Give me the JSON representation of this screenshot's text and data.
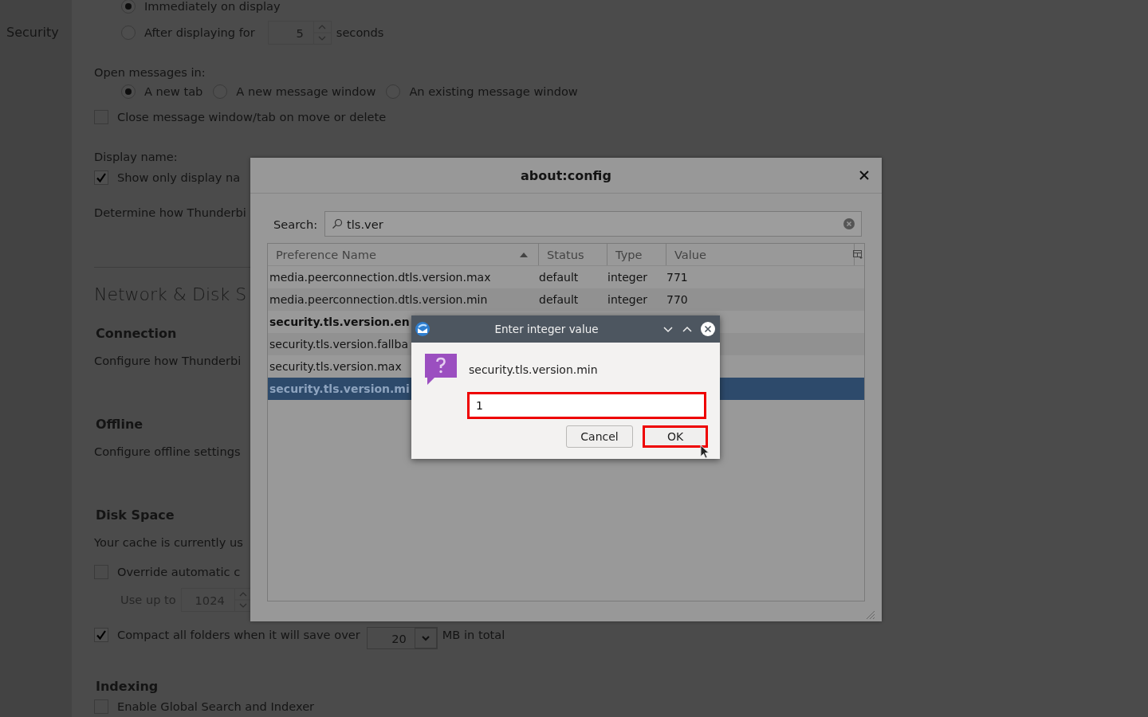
{
  "sidebar": {
    "items": [
      {
        "label": "Security"
      }
    ]
  },
  "settings": [
    {
      "kind": "radio",
      "label": "Immediately on display",
      "selected": true
    },
    {
      "kind": "radio-spin",
      "label": "After displaying for",
      "selected": false,
      "value": "5",
      "unit": "seconds"
    },
    {
      "kind": "label",
      "text": "Open messages in:"
    },
    {
      "kind": "radio-row",
      "options": [
        {
          "label": "A new tab",
          "selected": true
        },
        {
          "label": "A new message window",
          "selected": false
        },
        {
          "label": "An existing message window",
          "selected": false
        }
      ]
    },
    {
      "kind": "checkbox",
      "label": "Close message window/tab on move or delete",
      "checked": false
    },
    {
      "kind": "label",
      "text": "Display name:"
    },
    {
      "kind": "checkbox",
      "label": "Show only display na",
      "checked": true
    },
    {
      "kind": "text",
      "text": "Determine how Thunderbi"
    },
    {
      "kind": "section-title",
      "text": "Network & Disk S"
    },
    {
      "kind": "heading",
      "text": "Connection"
    },
    {
      "kind": "text",
      "text": "Configure how Thunderbi"
    },
    {
      "kind": "heading",
      "text": "Offline"
    },
    {
      "kind": "text",
      "text": "Configure offline settings"
    },
    {
      "kind": "heading",
      "text": "Disk Space"
    },
    {
      "kind": "text",
      "text": "Your cache is currently us"
    },
    {
      "kind": "checkbox",
      "label": "Override automatic c",
      "checked": false
    },
    {
      "kind": "spin",
      "label": "Use up to",
      "value": "1024",
      "disabled": true
    },
    {
      "kind": "checkbox-menu",
      "label": "Compact all folders when it will save over",
      "checked": true,
      "value": "20",
      "unit": "MB in total"
    },
    {
      "kind": "heading",
      "text": "Indexing"
    },
    {
      "kind": "checkbox",
      "label": "Enable Global Search and Indexer",
      "checked": false
    }
  ],
  "config_dialog": {
    "title": "about:config",
    "search": {
      "label": "Search:",
      "value": "tls.ver"
    },
    "table": {
      "columns": [
        "Preference Name",
        "Status",
        "Type",
        "Value"
      ],
      "rows": [
        {
          "name": "media.peerconnection.dtls.version.max",
          "status": "default",
          "type": "integer",
          "value": "771",
          "user_set": false,
          "selected": false
        },
        {
          "name": "media.peerconnection.dtls.version.min",
          "status": "default",
          "type": "integer",
          "value": "770",
          "user_set": false,
          "selected": false
        },
        {
          "name": "security.tls.version.en",
          "user_set": true,
          "selected": false
        },
        {
          "name": "security.tls.version.fallba",
          "user_set": false,
          "selected": false
        },
        {
          "name": "security.tls.version.max",
          "user_set": false,
          "selected": false
        },
        {
          "name": "security.tls.version.mi",
          "user_set": true,
          "selected": true
        }
      ]
    }
  },
  "prompt": {
    "title": "Enter integer value",
    "message": "security.tls.version.min",
    "value": "1",
    "highlighted": true,
    "buttons": [
      {
        "label": "Cancel",
        "highlighted": false
      },
      {
        "label": "OK",
        "highlighted": true
      }
    ]
  }
}
